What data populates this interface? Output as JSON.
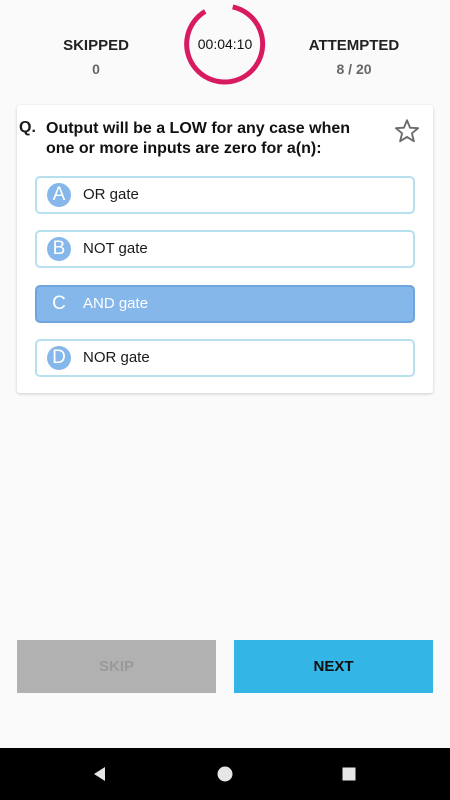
{
  "stats": {
    "skipped_label": "SKIPPED",
    "skipped_value": "0",
    "attempted_label": "ATTEMPTED",
    "attempted_value": "8 / 20"
  },
  "timer": {
    "time": "00:04:10",
    "ring_color": "#d81b60"
  },
  "question": {
    "prefix": "Q.",
    "text": "Output will be a LOW for any case when one or more inputs are zero for a(n):",
    "bookmark_icon": "star-outline-icon"
  },
  "options": [
    {
      "letter": "A",
      "text": "OR gate",
      "selected": false
    },
    {
      "letter": "B",
      "text": "NOT gate",
      "selected": false
    },
    {
      "letter": "C",
      "text": "AND gate",
      "selected": true
    },
    {
      "letter": "D",
      "text": "NOR gate",
      "selected": false
    }
  ],
  "buttons": {
    "skip_label": "SKIP",
    "next_label": "NEXT"
  },
  "colors": {
    "accent": "#33b5e5",
    "option_fill": "#86b7ea",
    "option_border": "#b7e0ef",
    "timer_ring": "#d81b60"
  },
  "navbar": {
    "icons": [
      "back-triangle-icon",
      "home-circle-icon",
      "recents-square-icon"
    ]
  }
}
